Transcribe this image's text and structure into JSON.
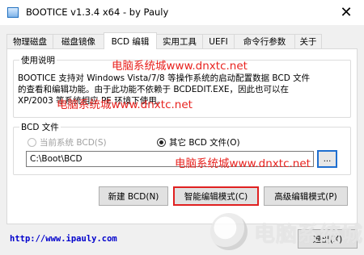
{
  "window": {
    "title": "BOOTICE v1.3.4 x64 - by Pauly",
    "close_glyph": "✕"
  },
  "tabs": [
    {
      "label": "物理磁盘",
      "active": false
    },
    {
      "label": "磁盘镜像",
      "active": false
    },
    {
      "label": "BCD 编辑",
      "active": true
    },
    {
      "label": "实用工具",
      "active": false
    },
    {
      "label": "UEFI",
      "active": false
    },
    {
      "label": "命令行参数",
      "active": false
    },
    {
      "label": "关于",
      "active": false
    }
  ],
  "usage_group": {
    "legend": "使用说明",
    "lines": [
      "BOOTICE 支持对 Windows Vista/7/8 等操作系统的启动配置数据 BCD 文件",
      "的查看和编辑功能。由于此功能不依赖于 BCDEDIT.EXE，因此也可以在",
      "XP/2003 等系统相应 PE 环境下使用。"
    ]
  },
  "bcd_group": {
    "legend": "BCD 文件",
    "radio_current": "当前系统 BCD(S)",
    "radio_other": "其它 BCD 文件(O)",
    "path_value": "C:\\Boot\\BCD",
    "browse_label": "..."
  },
  "buttons": {
    "new_bcd": "新建 BCD(N)",
    "smart_edit": "智能编辑模式(C)",
    "advanced_edit": "高级编辑模式(P)",
    "exit": "退出(X)"
  },
  "footer": {
    "link": "http://www.ipauly.com"
  },
  "watermarks": [
    "电脑系统城www.dnxtc.net",
    "电脑系统城www.dnxtc.net",
    "电脑系统城www.dnxtc.net"
  ],
  "corner_logo_text": "电脑系统城",
  "colors": {
    "watermark": "#e8231f",
    "link": "#0000cc",
    "highlight": "#e02020",
    "focus": "#1f6fd0"
  }
}
